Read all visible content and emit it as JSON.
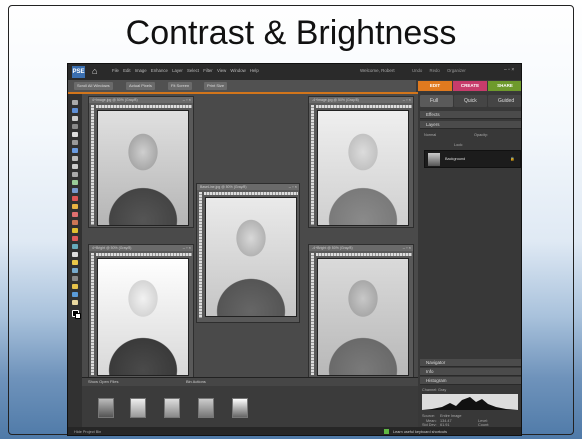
{
  "slide": {
    "title": "Contrast & Brightness"
  },
  "menubar": {
    "logo": "PSE",
    "items": [
      "File",
      "Edit",
      "Image",
      "Enhance",
      "Layer",
      "Select",
      "Filter",
      "View",
      "Window",
      "Help"
    ],
    "welcome": "Welcome, Robert",
    "right_items": [
      "Undo",
      "Redo",
      "Organizer"
    ],
    "window_controls": "‒ ▫ ×"
  },
  "options": {
    "buttons": [
      "Scroll All Windows",
      "Actual Pixels",
      "Fit Screen",
      "Print Size"
    ]
  },
  "mode_tabs": {
    "tabs": [
      "EDIT",
      "CREATE",
      "SHARE"
    ],
    "colors": [
      "#e07a1f",
      "#c73c6b",
      "#6e9a2c"
    ]
  },
  "panel": {
    "modes": [
      "Full",
      "Quick",
      "Guided"
    ],
    "effects": "Effects",
    "layers": "Layers",
    "blend": "Normal",
    "opacity": "Opacity:",
    "lock": "Lock:",
    "layer_name": "Background",
    "navigator": "Navigator",
    "info": "Info",
    "histogram": "Histogram",
    "channel_label": "Channel:",
    "channel": "Gray",
    "source": "Source:",
    "source_val": "Entire Image",
    "mean": "Mean:",
    "mean_val": "134.47",
    "stddev": "Std Dev:",
    "stddev_val": "61.91",
    "level": "Level:",
    "count": "Count:"
  },
  "docs": {
    "d1": "4+Image.jpg @ 50% (Gray/8)",
    "d2": "BaseLine.jpg @ 50% (Gray/8)",
    "d3": "-4+Image.jpg @ 50% (Gray/8)",
    "d4": "4+Bright @ 50% (Gray/8)",
    "d5": "-4+Bright @ 50% (Gray/8)"
  },
  "bin": {
    "show": "Show Open Files",
    "actions": "Bin Actions"
  },
  "status": {
    "left": "Hide Project Bin",
    "right": "Learn useful keyboard shortcuts"
  }
}
